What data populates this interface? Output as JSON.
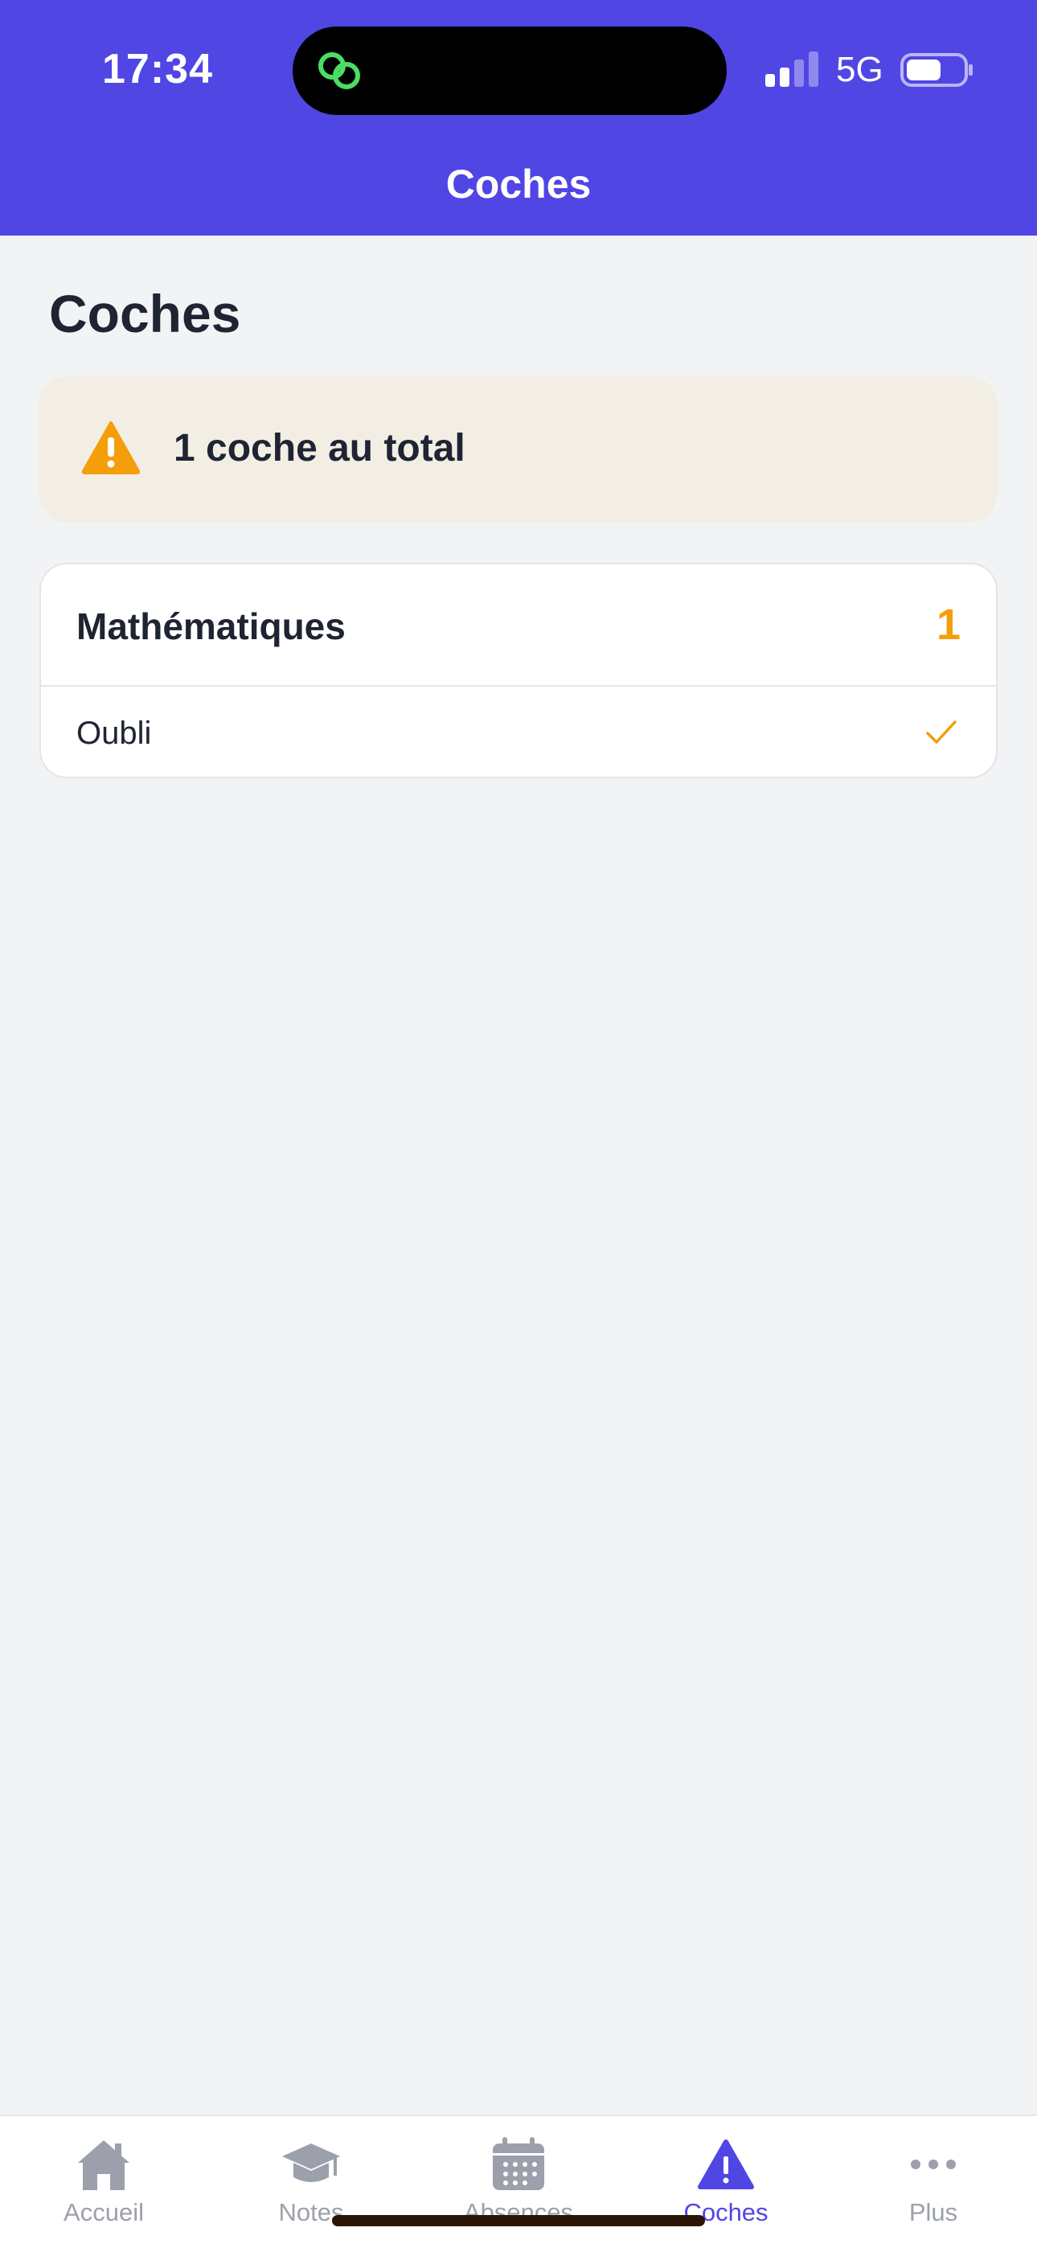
{
  "status_bar": {
    "time": "17:34",
    "network": "5G",
    "island_icon": "link-icon",
    "accent_green": "#4ADE64"
  },
  "nav": {
    "title": "Coches"
  },
  "page": {
    "title": "Coches"
  },
  "summary": {
    "icon": "warning-icon",
    "text": "1 coche au total"
  },
  "subjects": [
    {
      "name": "Mathématiques",
      "count": "1",
      "entries": [
        {
          "label": "Oubli",
          "icon": "check-icon"
        }
      ]
    }
  ],
  "tabs": [
    {
      "label": "Accueil",
      "icon": "home-icon",
      "active": false
    },
    {
      "label": "Notes",
      "icon": "graduation-cap-icon",
      "active": false
    },
    {
      "label": "Absences",
      "icon": "calendar-icon",
      "active": false
    },
    {
      "label": "Coches",
      "icon": "warning-icon",
      "active": true
    },
    {
      "label": "Plus",
      "icon": "more-icon",
      "active": false
    }
  ],
  "colors": {
    "brand": "#5046E4",
    "warning": "#F59E0B",
    "summary_bg": "#F3EEE4",
    "page_bg": "#F2F3F5",
    "tab_inactive": "#9CA0AB"
  }
}
